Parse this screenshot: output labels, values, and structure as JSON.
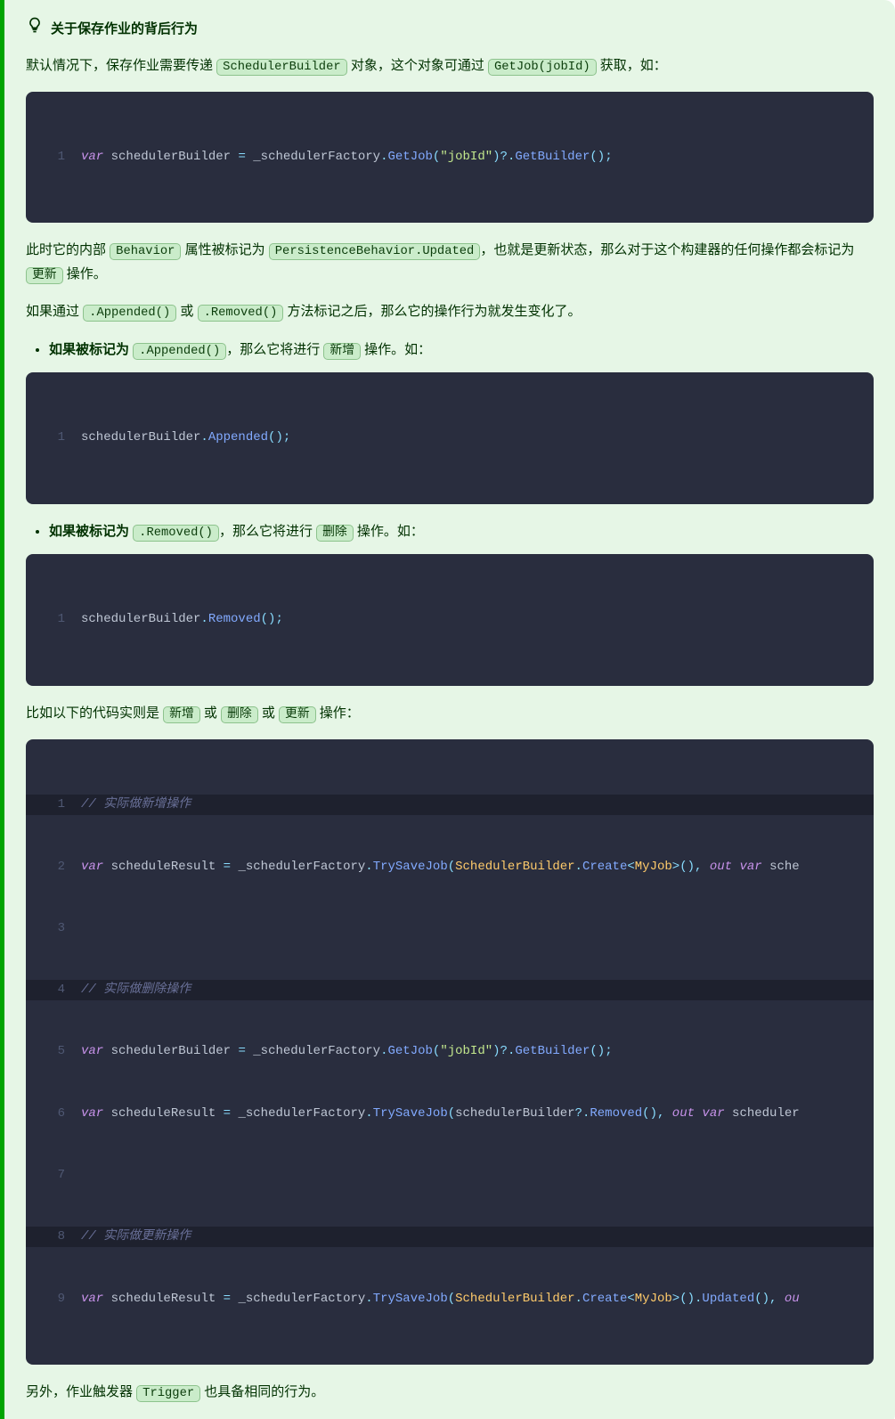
{
  "callout": {
    "title": "关于保存作业的背后行为",
    "para1_a": "默认情况下，保存作业需要传递 ",
    "code_sb": "SchedulerBuilder",
    "para1_b": " 对象，这个对象可通过 ",
    "code_getjob": "GetJob(jobId)",
    "para1_c": " 获取，如：",
    "code1": {
      "ln": "1",
      "kw_var": "var",
      "sp": " ",
      "id1": "schedulerBuilder ",
      "eq": "=",
      "id2": " _schedulerFactory",
      "dot": ".",
      "fn_getjob": "GetJob",
      "lp": "(",
      "str_jobid": "\"jobId\"",
      "rp": ")",
      "qdot": "?.",
      "fn_gb": "GetBuilder",
      "lp2": "(",
      "rp2": ")",
      "semi": ";"
    },
    "para2_a": "此时它的内部 ",
    "code_beh": "Behavior",
    "para2_b": " 属性被标记为 ",
    "code_pbu": "PersistenceBehavior.Updated",
    "para2_c": "，也就是更新状态，那么对于这个构建器的任何操作都会标记为 ",
    "code_upd": "更新",
    "para2_d": " 操作。",
    "para3_a": "如果通过 ",
    "code_app": ".Appended()",
    "para3_b": " 或 ",
    "code_rem": ".Removed()",
    "para3_c": " 方法标记之后，那么它的操作行为就发生变化了。",
    "bullet1_a": "如果被标记为 ",
    "bullet1_code": ".Appended()",
    "bullet1_b": "，那么它将进行 ",
    "bullet1_code2": "新增",
    "bullet1_c": " 操作。如：",
    "code2": {
      "ln": "1",
      "id": "schedulerBuilder",
      "dot": ".",
      "fn": "Appended",
      "lp": "(",
      "rp": ")",
      "semi": ";"
    },
    "bullet2_a": "如果被标记为 ",
    "bullet2_code": ".Removed()",
    "bullet2_b": "，那么它将进行 ",
    "bullet2_code2": "删除",
    "bullet2_c": " 操作。如：",
    "code3": {
      "ln": "1",
      "id": "schedulerBuilder",
      "dot": ".",
      "fn": "Removed",
      "lp": "(",
      "rp": ")",
      "semi": ";"
    },
    "para4_a": "比如以下的代码实则是 ",
    "code_xin": "新增",
    "para4_b": " 或 ",
    "code_del": "删除",
    "para4_c": " 或 ",
    "code_upd2": "更新",
    "para4_d": " 操作：",
    "code4": {
      "l1": {
        "ln": "1",
        "cmt": "// 实际做新增操作"
      },
      "l2": {
        "ln": "2",
        "kw": "var",
        "sp": " ",
        "id1": "scheduleResult ",
        "eq": "=",
        "id2": " _schedulerFactory",
        "dot": ".",
        "fn": "TrySaveJob",
        "lp": "(",
        "cls": "SchedulerBuilder",
        "dot2": ".",
        "fn2": "Create",
        "lt": "<",
        "cls2": "MyJob",
        "gt": ">",
        "lp2": "(",
        "rp2": ")",
        "comma": ", ",
        "kw2": "out",
        "sp2": " ",
        "kw3": "var",
        "id3": " sche"
      },
      "l3": {
        "ln": "3"
      },
      "l4": {
        "ln": "4",
        "cmt": "// 实际做删除操作"
      },
      "l5": {
        "ln": "5",
        "kw": "var",
        "sp": " ",
        "id1": "schedulerBuilder ",
        "eq": "=",
        "id2": " _schedulerFactory",
        "dot": ".",
        "fn": "GetJob",
        "lp": "(",
        "str": "\"jobId\"",
        "rp": ")",
        "qdot": "?.",
        "fn2": "GetBuilder",
        "lp2": "(",
        "rp2": ")",
        "semi": ";"
      },
      "l6": {
        "ln": "6",
        "kw": "var",
        "sp": " ",
        "id1": "scheduleResult ",
        "eq": "=",
        "id2": " _schedulerFactory",
        "dot": ".",
        "fn": "TrySaveJob",
        "lp": "(",
        "id3": "schedulerBuilder",
        "qdot": "?.",
        "fn2": "Removed",
        "lp2": "(",
        "rp2": ")",
        "comma": ", ",
        "kw2": "out",
        "sp2": " ",
        "kw3": "var",
        "id4": " scheduler"
      },
      "l7": {
        "ln": "7"
      },
      "l8": {
        "ln": "8",
        "cmt": "// 实际做更新操作"
      },
      "l9": {
        "ln": "9",
        "kw": "var",
        "sp": " ",
        "id1": "scheduleResult ",
        "eq": "=",
        "id2": " _schedulerFactory",
        "dot": ".",
        "fn": "TrySaveJob",
        "lp": "(",
        "cls": "SchedulerBuilder",
        "dot2": ".",
        "fn2": "Create",
        "lt": "<",
        "cls2": "MyJob",
        "gt": ">",
        "lp2": "(",
        "rp2": ")",
        "dot3": ".",
        "fn3": "Updated",
        "lp3": "(",
        "rp3": ")",
        "comma": ", ",
        "kw2": "ou"
      }
    },
    "para5_a": "另外，作业触发器 ",
    "code_trig": "Trigger",
    "para5_b": " 也具备相同的行为。"
  }
}
